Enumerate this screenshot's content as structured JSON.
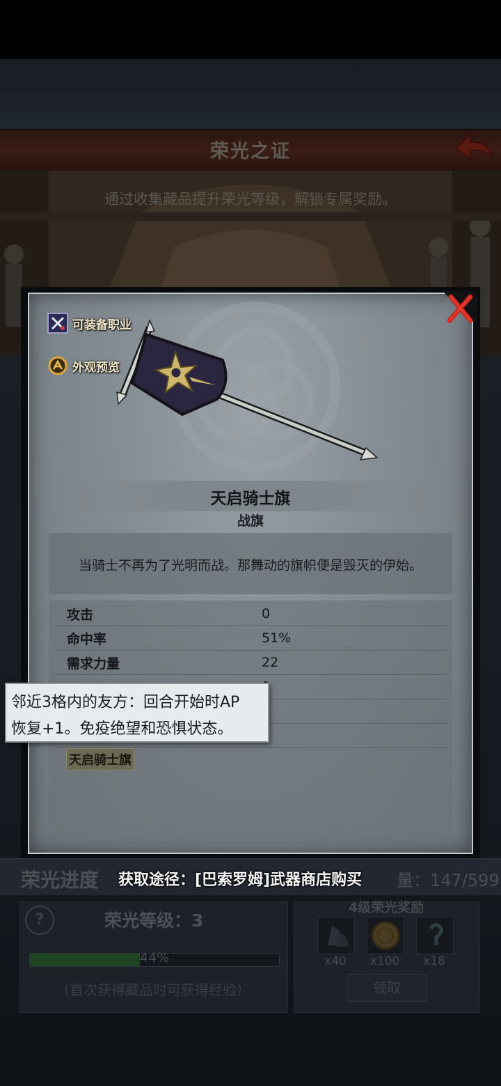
{
  "header": {
    "title": "荣光之证"
  },
  "hall": {
    "description": "通过收集藏品提升荣光等级，解锁专属奖励。"
  },
  "dialog": {
    "side_buttons": [
      {
        "label": "可装备职业",
        "icon": "crossed-swords-icon"
      },
      {
        "label": "外观预览",
        "icon": "mannequin-icon"
      }
    ],
    "item": {
      "name": "天启骑士旗",
      "type": "战旗",
      "description": "当骑士不再为了光明而战。那舞动的旗帜便是毁灭的伊始。",
      "stats": [
        {
          "label": "攻击",
          "value": "0"
        },
        {
          "label": "命中率",
          "value": "51%"
        },
        {
          "label": "需求力量",
          "value": "22"
        },
        {
          "label": "",
          "value": "0"
        }
      ],
      "set_link": "天启骑士旗"
    },
    "tooltip": {
      "line1": "邻近3格内的友方：回合开始时AP",
      "line2": "恢复+1。免疫绝望和恐惧状态。"
    },
    "obtain": "获取途径：[巴索罗姆]武器商店购买"
  },
  "progress": {
    "title": "荣光进度",
    "collected": "量：147/599",
    "glory_level": "荣光等级：3",
    "exp_percent": 44,
    "exp_label": "44%",
    "note": "（首次获得藏品时可获得经验）",
    "reward_title": "4级荣光奖励",
    "rewards": [
      {
        "icon": "crystal-icon",
        "qty": "x40"
      },
      {
        "icon": "gold-coin-icon",
        "qty": "x100"
      },
      {
        "icon": "hook-icon",
        "qty": "x18"
      }
    ],
    "claim_label": "领取"
  },
  "colors": {
    "accent_red": "#c8261c",
    "panel_gray": "#848c93",
    "tooltip_bg": "#e8ebee"
  }
}
